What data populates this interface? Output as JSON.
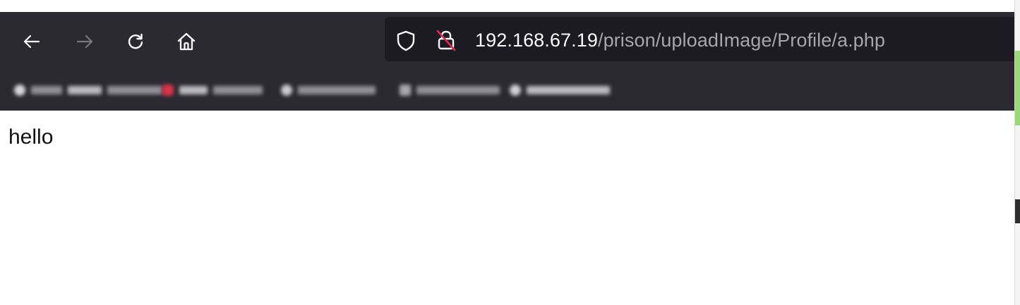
{
  "browser": {
    "nav": {
      "back": "back-arrow-icon",
      "forward": "forward-arrow-icon",
      "reload": "reload-icon",
      "home": "home-icon"
    },
    "urlbar": {
      "host": "192.168.67.19",
      "path": "/prison/uploadImage/Profile/a.php",
      "tracking_icon": "shield-icon",
      "security_icon": "insecure-lock-icon"
    },
    "bookmarks_blurred": true
  },
  "page": {
    "body_text": "hello"
  },
  "colors": {
    "toolbar_bg": "#2b2a33",
    "urlbar_bg": "#1c1b22",
    "url_host": "#fbfbfe",
    "url_path": "#a7a6ad",
    "insecure_slash": "#e22850"
  }
}
